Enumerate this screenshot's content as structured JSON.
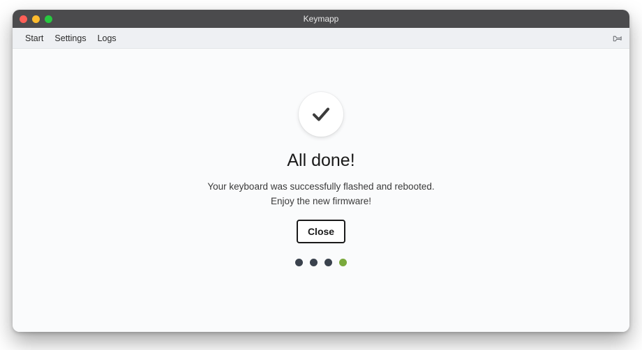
{
  "window": {
    "title": "Keymapp"
  },
  "menu": {
    "items": [
      {
        "id": "start",
        "label": "Start"
      },
      {
        "id": "settings",
        "label": "Settings"
      },
      {
        "id": "logs",
        "label": "Logs"
      }
    ]
  },
  "main": {
    "heading": "All done!",
    "message_line1": "Your keyboard was successfully flashed and rebooted.",
    "message_line2": "Enjoy the new firmware!",
    "close_label": "Close"
  },
  "progress": {
    "steps": 4,
    "current": 4
  },
  "colors": {
    "dot_inactive": "#3a424d",
    "dot_active": "#7aa93c"
  }
}
